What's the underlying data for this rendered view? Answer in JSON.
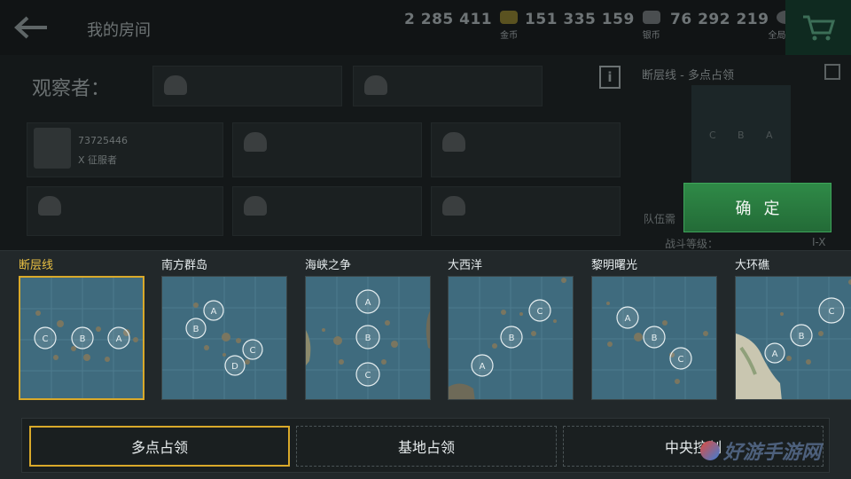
{
  "topbar": {
    "title": "我的房间",
    "gold_value": "2 285 411",
    "gold_label": "金币",
    "silver_value": "151 335 159",
    "silver_label": "银币",
    "exp_value": "76 292 219",
    "exp_label": "全局经验"
  },
  "room": {
    "observers_label": "观察者：",
    "player_id": "73725446",
    "player_rank": "X 征服者",
    "mode_title": "断层线 - 多点占领",
    "info_icon": "i",
    "minimap_labels": [
      "C",
      "B",
      "A"
    ],
    "side_text1": "队伍需",
    "side_text2": "战斗等级：",
    "side_value": "I-X"
  },
  "confirm_label": "确定",
  "maps": [
    {
      "name": "断层线",
      "selected": true
    },
    {
      "name": "南方群岛",
      "selected": false
    },
    {
      "name": "海峡之争",
      "selected": false
    },
    {
      "name": "大西洋",
      "selected": false
    },
    {
      "name": "黎明曙光",
      "selected": false
    },
    {
      "name": "大环礁",
      "selected": false
    }
  ],
  "modes": [
    {
      "label": "多点占领",
      "active": true
    },
    {
      "label": "基地占领",
      "active": false
    },
    {
      "label": "中央控制",
      "active": false
    }
  ],
  "watermark": "好游手游网",
  "colors": {
    "accent_gold": "#d9a92a",
    "confirm_green": "#2f8a47",
    "sea": "#3f6b7e"
  }
}
